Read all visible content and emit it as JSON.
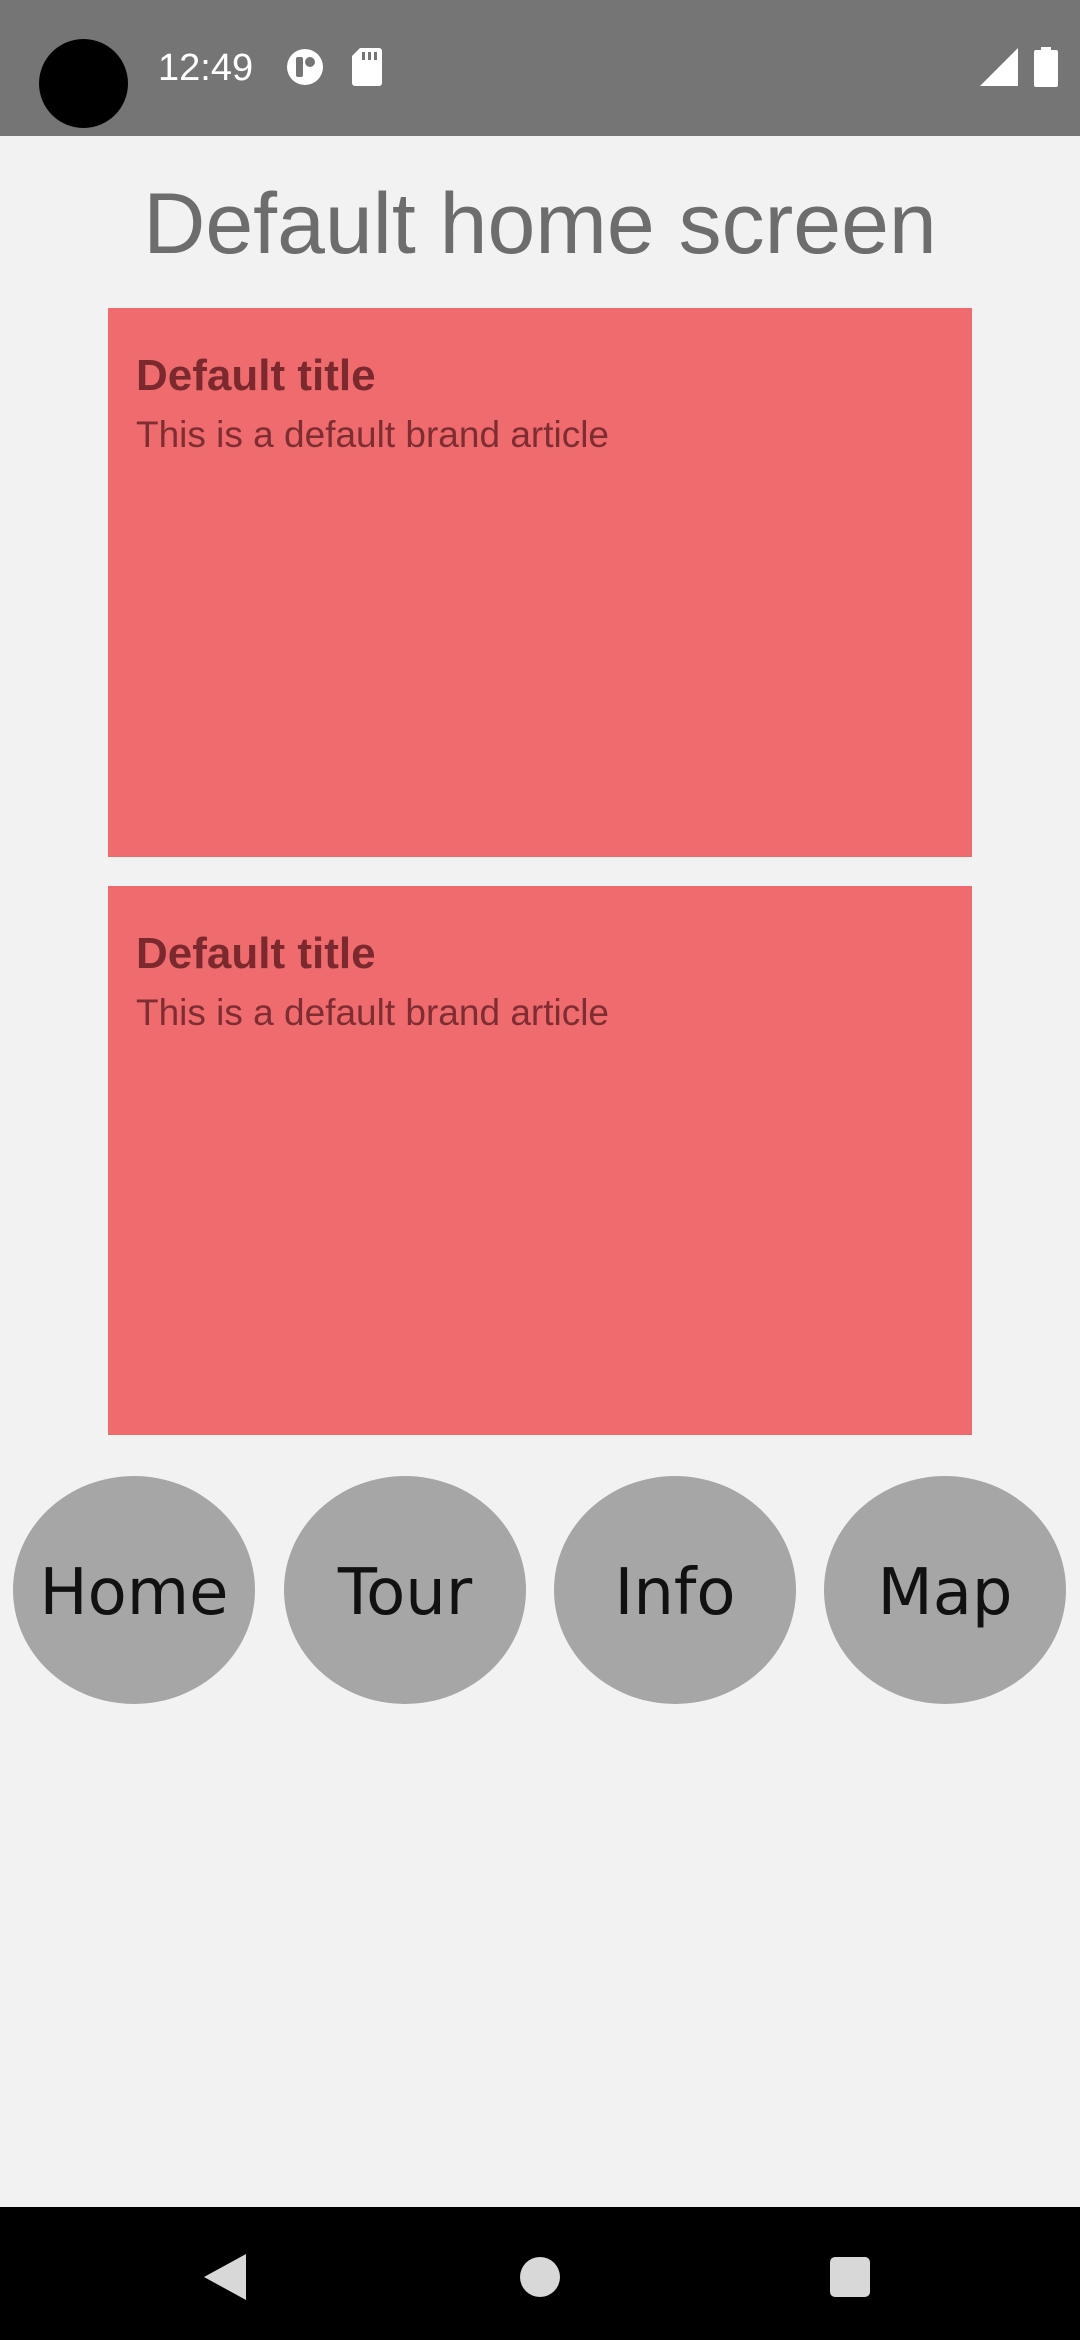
{
  "status_bar": {
    "time": "12:49",
    "icons": [
      "notification-icon",
      "sd-card-icon",
      "signal-icon",
      "battery-icon"
    ]
  },
  "page": {
    "title": "Default home screen"
  },
  "cards": [
    {
      "title": "Default title",
      "description": "This is a default brand article"
    },
    {
      "title": "Default title",
      "description": "This is a default brand article"
    }
  ],
  "nav": {
    "home_label": "Home",
    "tour_label": "Tour",
    "info_label": "Info",
    "map_label": "Map"
  },
  "system_nav": {
    "icons": [
      "back-icon",
      "home-icon",
      "recents-icon"
    ]
  },
  "colors": {
    "status_bar": "#757575",
    "background": "#f2f2f2",
    "card": "#ef6b6e",
    "card_text": "#7a2a2e",
    "nav_button": "#a6a6a6"
  }
}
